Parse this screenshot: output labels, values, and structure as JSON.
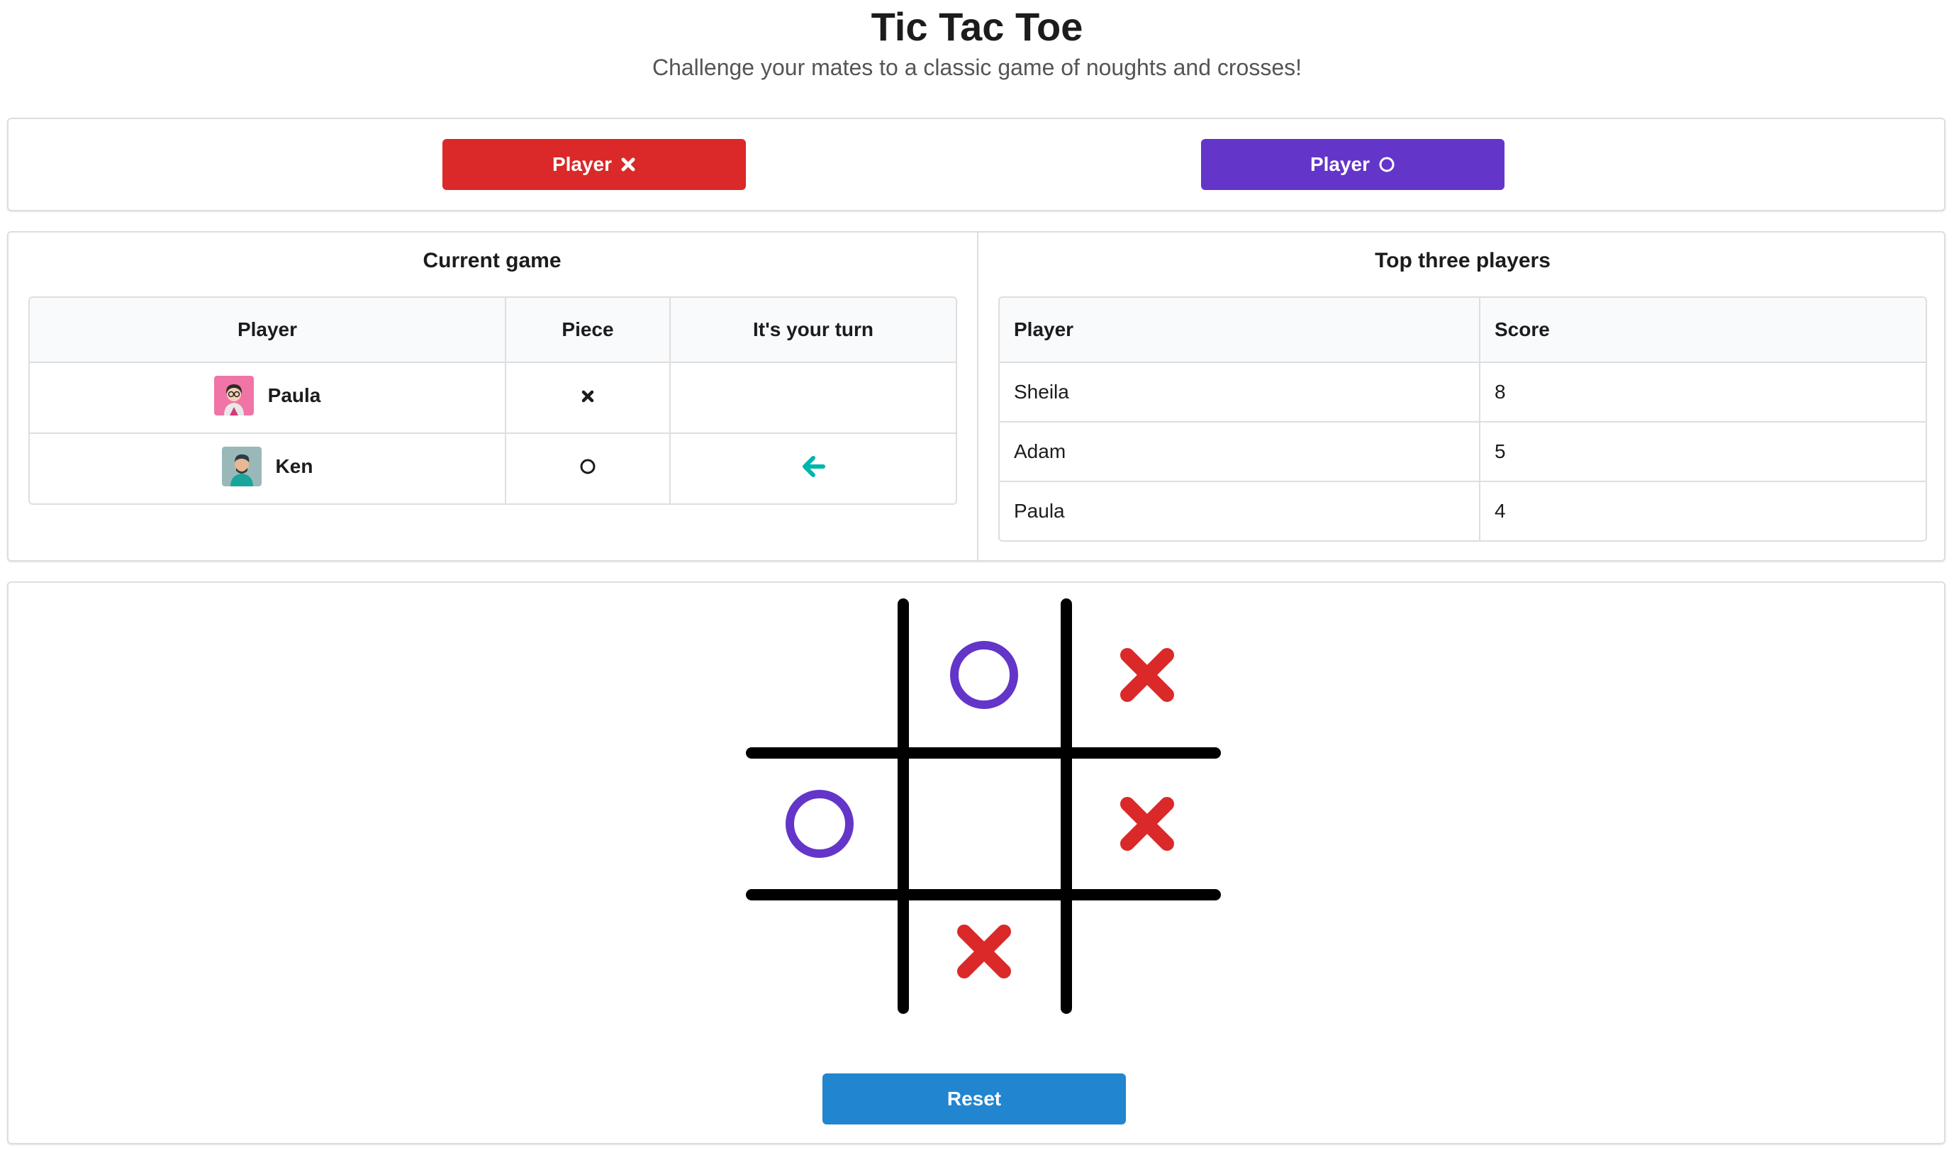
{
  "header": {
    "title": "Tic Tac Toe",
    "subtitle": "Challenge your mates to a classic game of noughts and crosses!"
  },
  "player_buttons": {
    "x_label": "Player",
    "o_label": "Player"
  },
  "current_game": {
    "title": "Current game",
    "columns": [
      "Player",
      "Piece",
      "It's your turn"
    ],
    "rows": [
      {
        "name": "Paula",
        "piece": "cross",
        "turn": false
      },
      {
        "name": "Ken",
        "piece": "nought",
        "turn": true
      }
    ]
  },
  "top_players": {
    "title": "Top three players",
    "columns": [
      "Player",
      "Score"
    ],
    "rows": [
      {
        "name": "Sheila",
        "score": "8"
      },
      {
        "name": "Adam",
        "score": "5"
      },
      {
        "name": "Paula",
        "score": "4"
      }
    ]
  },
  "board": {
    "cells": [
      "",
      "O",
      "X",
      "O",
      "",
      "X",
      "",
      "X",
      ""
    ]
  },
  "reset_label": "Reset",
  "colors": {
    "x_red": "#db2828",
    "o_purple": "#6435c9",
    "reset_blue": "#2185d0",
    "turn_teal": "#00b5ad"
  }
}
